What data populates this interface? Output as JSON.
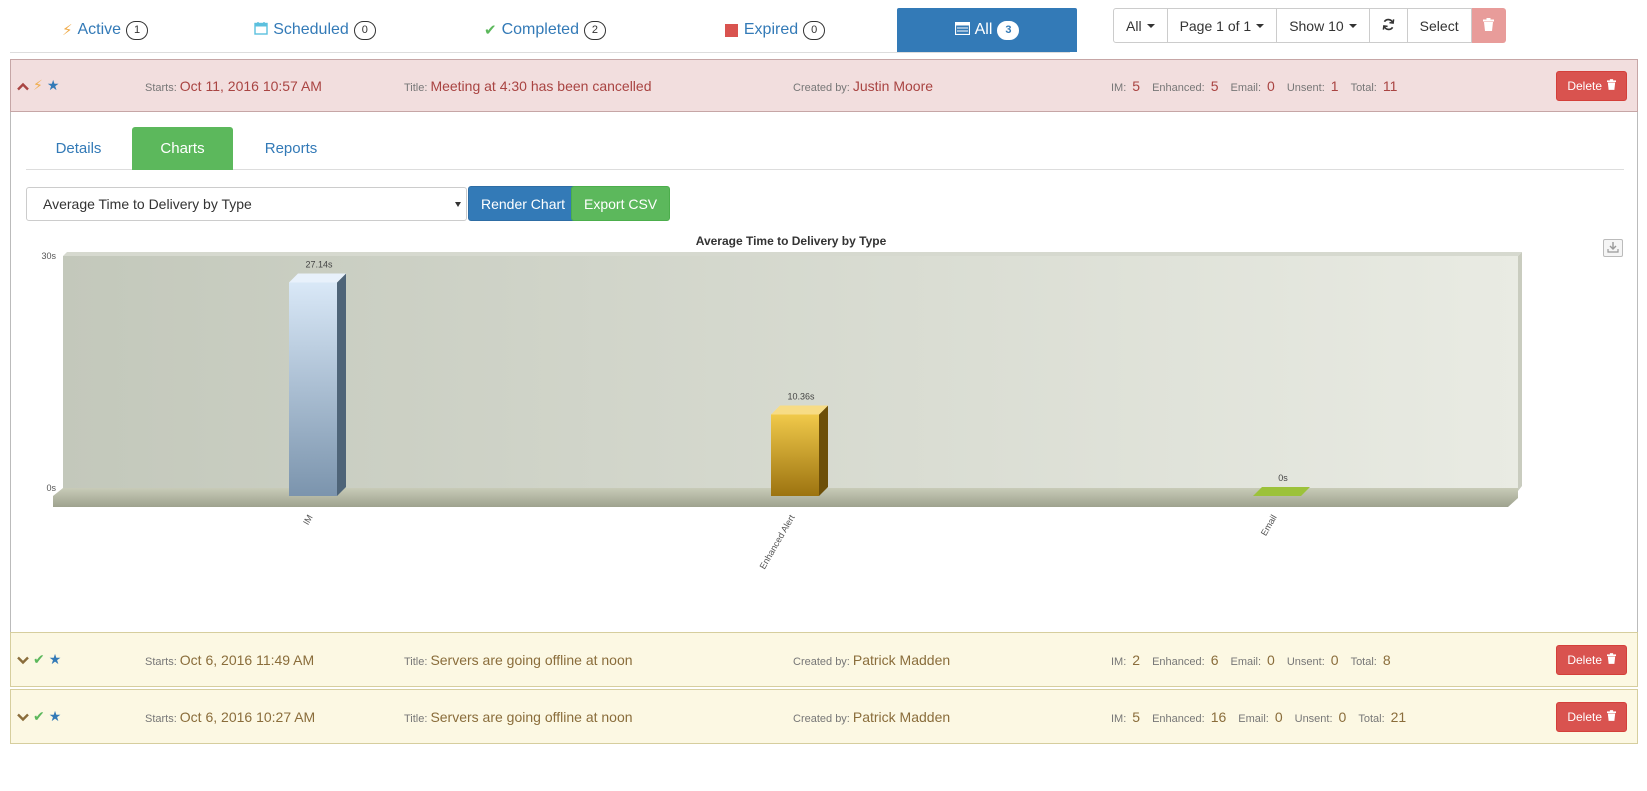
{
  "status_tabs": [
    {
      "label": "Active",
      "count": "1",
      "icon": "bolt-icon"
    },
    {
      "label": "Scheduled",
      "count": "0",
      "icon": "calendar-icon"
    },
    {
      "label": "Completed",
      "count": "2",
      "icon": "check-icon"
    },
    {
      "label": "Expired",
      "count": "0",
      "icon": "stop-icon"
    },
    {
      "label": "All",
      "count": "3",
      "icon": "list-icon"
    }
  ],
  "toolbar": {
    "filter": "All",
    "page": "Page 1 of 1",
    "show": "Show 10",
    "select": "Select"
  },
  "alerts": [
    {
      "starts_label": "Starts:",
      "starts": "Oct 11, 2016 10:57 AM",
      "title_label": "Title:",
      "title": "Meeting at 4:30 has been cancelled",
      "created_label": "Created by:",
      "created_by": "Justin Moore",
      "im_label": "IM:",
      "im": "5",
      "enhanced_label": "Enhanced:",
      "enhanced": "5",
      "email_label": "Email:",
      "email": "0",
      "unsent_label": "Unsent:",
      "unsent": "1",
      "total_label": "Total:",
      "total": "11",
      "delete": "Delete"
    },
    {
      "starts_label": "Starts:",
      "starts": "Oct 6, 2016 11:49 AM",
      "title_label": "Title:",
      "title": "Servers are going offline at noon",
      "created_label": "Created by:",
      "created_by": "Patrick Madden",
      "im_label": "IM:",
      "im": "2",
      "enhanced_label": "Enhanced:",
      "enhanced": "6",
      "email_label": "Email:",
      "email": "0",
      "unsent_label": "Unsent:",
      "unsent": "0",
      "total_label": "Total:",
      "total": "8",
      "delete": "Delete"
    },
    {
      "starts_label": "Starts:",
      "starts": "Oct 6, 2016 10:27 AM",
      "title_label": "Title:",
      "title": "Servers are going offline at noon",
      "created_label": "Created by:",
      "created_by": "Patrick Madden",
      "im_label": "IM:",
      "im": "5",
      "enhanced_label": "Enhanced:",
      "enhanced": "16",
      "email_label": "Email:",
      "email": "0",
      "unsent_label": "Unsent:",
      "unsent": "0",
      "total_label": "Total:",
      "total": "21",
      "delete": "Delete"
    }
  ],
  "detail_tabs": [
    "Details",
    "Charts",
    "Reports"
  ],
  "chart_controls": {
    "selected_chart": "Average Time to Delivery by Type",
    "render_label": "Render Chart",
    "export_label": "Export CSV"
  },
  "colors": {
    "primary": "#337ab7",
    "success": "#5cb85c",
    "danger": "#d9534f",
    "active_row": "#f2dede",
    "completed_row": "#fcf8e3"
  },
  "chart_data": {
    "type": "bar",
    "title": "Average Time to Delivery by Type",
    "categories": [
      "IM",
      "Enhanced Alert",
      "Email"
    ],
    "values": [
      27.14,
      10.36,
      0
    ],
    "value_labels": [
      "27.14s",
      "10.36s",
      "0s"
    ],
    "bar_colors": [
      "#a9c3dc",
      "#c9a02a",
      "#9cc23a"
    ],
    "xlabel": "",
    "ylabel": "",
    "ylim": [
      0,
      30
    ],
    "y_tick_labels": [
      "0s",
      "30s"
    ],
    "grid": false,
    "legend": "none"
  }
}
